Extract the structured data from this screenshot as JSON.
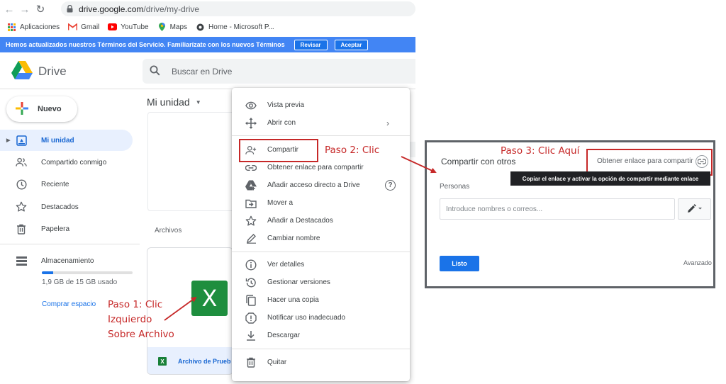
{
  "browser": {
    "url_host": "drive.google.com",
    "url_path": "/drive/my-drive",
    "bookmarks": [
      {
        "label": "Aplicaciones",
        "icon": "apps-grid-icon"
      },
      {
        "label": "Gmail",
        "icon": "gmail-icon"
      },
      {
        "label": "YouTube",
        "icon": "youtube-icon"
      },
      {
        "label": "Maps",
        "icon": "maps-icon"
      },
      {
        "label": "Home - Microsoft P...",
        "icon": "microsoft-icon"
      }
    ]
  },
  "banner": {
    "text": "Hemos actualizados nuestros Términos del Servicio. Familiarízate con los nuevos Términos",
    "review_label": "Revisar",
    "accept_label": "Aceptar"
  },
  "drive": {
    "brand": "Drive",
    "search_placeholder": "Buscar en Drive",
    "new_label": "Nuevo",
    "nav": [
      {
        "label": "Mi unidad",
        "icon": "my-drive-icon",
        "active": true
      },
      {
        "label": "Compartido conmigo",
        "icon": "shared-people-icon"
      },
      {
        "label": "Reciente",
        "icon": "clock-icon"
      },
      {
        "label": "Destacados",
        "icon": "star-icon"
      },
      {
        "label": "Papelera",
        "icon": "trash-icon"
      }
    ],
    "storage": {
      "label": "Almacenamiento",
      "usage": "1,9 GB de 15 GB usado",
      "used_fraction": 0.127,
      "buy_label": "Comprar espacio"
    },
    "breadcrumb": "Mi unidad",
    "files_label": "Archivos",
    "file": {
      "name": "Archivo de Prueb",
      "thumb_letter": "X",
      "small_icon": "X"
    }
  },
  "context_menu": {
    "items": [
      {
        "label": "Vista previa",
        "icon": "eye-icon"
      },
      {
        "label": "Abrir con",
        "icon": "move-arrows-icon",
        "submenu_glyph": "›"
      },
      {
        "label": "Compartir",
        "icon": "add-person-icon"
      },
      {
        "label": "Obtener enlace para compartir",
        "icon": "link-icon"
      },
      {
        "label": "Añadir acceso directo a Drive",
        "icon": "drive-shortcut-icon",
        "help_glyph": "?"
      },
      {
        "label": "Mover a",
        "icon": "move-to-folder-icon"
      },
      {
        "label": "Añadir a Destacados",
        "icon": "star-outline-icon"
      },
      {
        "label": "Cambiar nombre",
        "icon": "pencil-icon"
      },
      {
        "label": "Ver detalles",
        "icon": "info-icon"
      },
      {
        "label": "Gestionar versiones",
        "icon": "history-icon"
      },
      {
        "label": "Hacer una copia",
        "icon": "copy-icon"
      },
      {
        "label": "Notificar uso inadecuado",
        "icon": "report-icon"
      },
      {
        "label": "Descargar",
        "icon": "download-icon"
      },
      {
        "label": "Quitar",
        "icon": "trash-icon"
      }
    ]
  },
  "annotations": {
    "step1_lines": [
      "Paso 1: Clic",
      "Izquierdo",
      "Sobre Archivo"
    ],
    "step2": "Paso 2: Clic",
    "step3": "Paso 3: Clic Aquí",
    "color": "#c62828"
  },
  "share_dialog": {
    "title": "Compartir con otros",
    "get_link_label": "Obtener enlace para compartir",
    "tooltip": "Copiar el enlace y activar la opción de compartir mediante enlace",
    "people_label": "Personas",
    "input_placeholder": "Introduce nombres o correos...",
    "done_label": "Listo",
    "advanced_label": "Avanzado"
  }
}
